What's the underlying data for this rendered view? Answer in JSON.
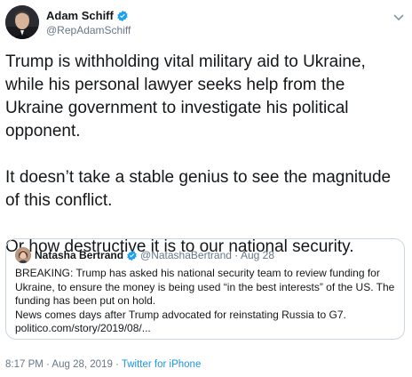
{
  "author": {
    "name": "Adam Schiff",
    "handle": "@RepAdamSchiff"
  },
  "tweet": {
    "paragraphs": [
      "Trump is withholding vital military aid to Ukraine, while his personal lawyer seeks help from the Ukraine government to investigate his political opponent.",
      "It doesn’t take a stable genius to see the magnitude of this conflict.",
      "Or how destructive it is to our national security."
    ]
  },
  "quoted_tweet": {
    "name": "Natasha Bertrand",
    "handle": "@NatashaBertrand",
    "separator": " · ",
    "date": "Aug 28",
    "lines": [
      "BREAKING: Trump has asked his national security team to review funding for Ukraine, to ensure the money is being used “in the best interests” of the US. The funding has been put on hold.",
      "News comes days after Trump advocated for reinstating Russia to G7.",
      "politico.com/story/2019/08/..."
    ]
  },
  "footer": {
    "time": "8:17 PM",
    "date": "Aug 28, 2019",
    "separator": " · ",
    "source": "Twitter for iPhone"
  },
  "colors": {
    "verified": "#1da1f2",
    "link": "#1b95e0",
    "secondary_text": "#657786",
    "border": "#ccd6dd"
  },
  "icons": [
    "verified-badge-icon",
    "chevron-down-icon"
  ]
}
